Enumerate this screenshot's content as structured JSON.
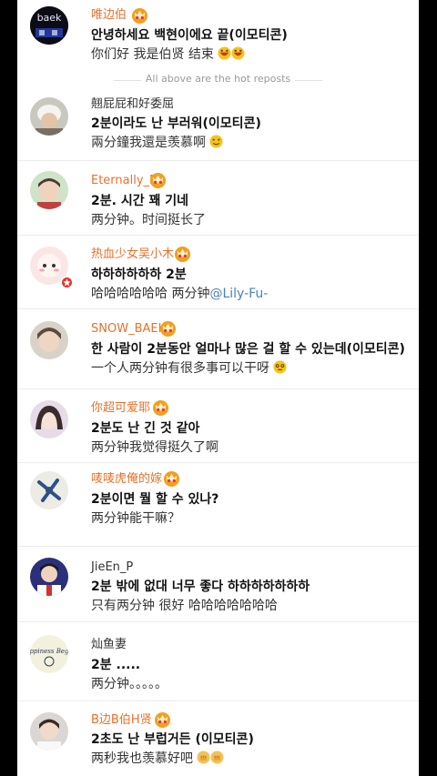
{
  "hot_divider": "All above are the hot reposts",
  "comments": [
    {
      "name": "唯边伯",
      "korean": "안녕하세요 백현이에요 끝(이모티콘)",
      "chinese": "你们好 我是伯贤 结束",
      "avatar_text": "baek"
    },
    {
      "name": "翹屁屁和好委屈",
      "korean": "2분이라도 난 부러워(이모티콘)",
      "chinese": "兩分鐘我還是羡慕啊"
    },
    {
      "name": "Eternally_B",
      "korean": "2분. 시간 꽤 기네",
      "chinese": "两分钟。时间挺长了"
    },
    {
      "name": "热血少女吴小木",
      "korean": "하하하하하하 2분",
      "chinese": "哈哈哈哈哈哈 两分钟",
      "mention": "@Lily-Fu-"
    },
    {
      "name": "SNOW_BAEK",
      "korean": "한 사람이 2분동안 얼마나 많은 걸 할 수 있는데(이모티콘)",
      "chinese": "一个人两分钟有很多事可以干呀"
    },
    {
      "name": "你超可爱耶",
      "korean": "2분도 난 긴 것 같아",
      "chinese": "两分钟我觉得挺久了啊"
    },
    {
      "name": "唛唛虎俺的嫁",
      "korean": "2분이면 뭘 할 수 있나?",
      "chinese": "两分钟能干嘛？"
    },
    {
      "name": "JieEn_P",
      "korean": "2분 밖에 없대 너무 좋다 하하하하하하하",
      "chinese": "只有两分钟 很好 哈哈哈哈哈哈哈"
    },
    {
      "name": "灿鱼妻",
      "korean": "2분 .....",
      "chinese": "两分钟。。。。。",
      "avatar_text": "Happiness Begins"
    },
    {
      "name": "B边B伯H贤",
      "korean": "2초도 난 부럽거든 (이모티콘)",
      "chinese": "两秒我也羡慕好吧"
    }
  ],
  "colors": {
    "orange_name": "#e8712b",
    "mention": "#4b7fbf",
    "crown": "#f2a01e",
    "badge": "#e5332a"
  }
}
